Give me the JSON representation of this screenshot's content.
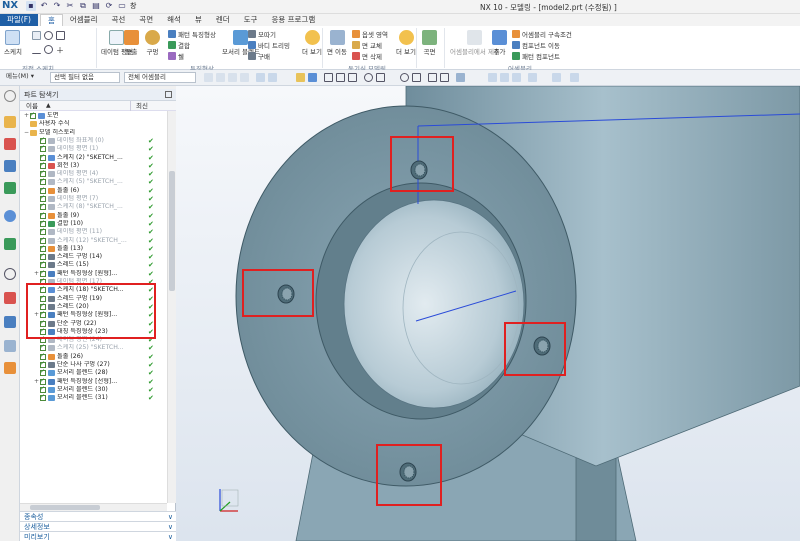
{
  "app": {
    "logo": "NX",
    "window_title": "NX 10 - 모델링 - [model2.prt (수정됨) ]",
    "qat_label": "창"
  },
  "menu": {
    "tabs": [
      "파일(F)",
      "홈",
      "어셈블리",
      "곡선",
      "곡면",
      "해석",
      "뷰",
      "렌더",
      "도구",
      "응용 프로그램"
    ],
    "active": "홈"
  },
  "ribbon": {
    "sketch": "스케치",
    "datum_plane": "데이텀 평면",
    "extrude": "돌출",
    "hole": "구멍",
    "pattern_feature": "패턴 특징형상",
    "unite": "결합",
    "shell": "쉘",
    "assembly_cut": "모서리 블렌드",
    "chamfer": "모따기",
    "draft": "바디 트리밍",
    "more1": "구배",
    "more_label": "더 보기",
    "offset_region": "옵셋 영역",
    "replace_face": "면 교체",
    "delete_face": "면 삭제",
    "move_face": "면 이동",
    "more2": "더 보기",
    "curve": "곡면",
    "assembly_constraints": "어셈블리 구속조건",
    "component_move": "컴포넌트 이동",
    "pattern_component": "패턴 컴포넌트",
    "add": "추가",
    "assembly_nav": "어셈블리에서 제품",
    "group_direct_sketch": "직접 스케치",
    "group_feature": "특징형상",
    "group_sync": "동기식 모델링",
    "group_assembly": "어셈블리"
  },
  "cmdbar": {
    "menu": "메뉴(M) ▾",
    "filter": "선택 필터 없음",
    "scope": "전체 어셈블리"
  },
  "navigator": {
    "title": "파트 탐색기",
    "col_name": "이름",
    "col_latest": "최신",
    "rows": [
      {
        "label": "도면",
        "depth": 0,
        "expand": "+",
        "icon": "#5a8fd6",
        "check": true,
        "latest": false,
        "dim": false
      },
      {
        "label": "사용자 수식",
        "depth": 0,
        "expand": "",
        "icon": "#e9b44c",
        "check": false,
        "latest": false,
        "dim": false
      },
      {
        "label": "모델 히스토리",
        "depth": 0,
        "expand": "−",
        "icon": "#e9b44c",
        "check": false,
        "latest": false,
        "dim": false
      },
      {
        "label": "데이텀 좌표계 (0)",
        "depth": 1,
        "expand": "",
        "icon": "#b0b8c4",
        "check": true,
        "latest": true,
        "dim": true
      },
      {
        "label": "데이텀 평면 (1)",
        "depth": 1,
        "expand": "",
        "icon": "#b0b8c4",
        "check": true,
        "latest": true,
        "dim": true
      },
      {
        "label": "스케치 (2) \"SKETCH_...",
        "depth": 1,
        "expand": "",
        "icon": "#5a8fd6",
        "check": true,
        "latest": true,
        "dim": false
      },
      {
        "label": "회전 (3)",
        "depth": 1,
        "expand": "",
        "icon": "#d9534f",
        "check": true,
        "latest": true,
        "dim": false
      },
      {
        "label": "데이텀 평면 (4)",
        "depth": 1,
        "expand": "",
        "icon": "#b0b8c4",
        "check": true,
        "latest": true,
        "dim": true
      },
      {
        "label": "스케치 (5) \"SKETCH_...",
        "depth": 1,
        "expand": "",
        "icon": "#b0b8c4",
        "check": true,
        "latest": true,
        "dim": true
      },
      {
        "label": "돌출 (6)",
        "depth": 1,
        "expand": "",
        "icon": "#e8903a",
        "check": true,
        "latest": true,
        "dim": false
      },
      {
        "label": "데이텀 평면 (7)",
        "depth": 1,
        "expand": "",
        "icon": "#b0b8c4",
        "check": true,
        "latest": true,
        "dim": true
      },
      {
        "label": "스케치 (8) \"SKETCH_...",
        "depth": 1,
        "expand": "",
        "icon": "#b0b8c4",
        "check": true,
        "latest": true,
        "dim": true
      },
      {
        "label": "돌출 (9)",
        "depth": 1,
        "expand": "",
        "icon": "#e8903a",
        "check": true,
        "latest": true,
        "dim": false
      },
      {
        "label": "결합 (10)",
        "depth": 1,
        "expand": "",
        "icon": "#3a9a5a",
        "check": true,
        "latest": true,
        "dim": false
      },
      {
        "label": "데이텀 평면 (11)",
        "depth": 1,
        "expand": "",
        "icon": "#b0b8c4",
        "check": true,
        "latest": true,
        "dim": true
      },
      {
        "label": "스케치 (12) \"SKETCH_...",
        "depth": 1,
        "expand": "",
        "icon": "#b0b8c4",
        "check": true,
        "latest": true,
        "dim": true
      },
      {
        "label": "돌출 (13)",
        "depth": 1,
        "expand": "",
        "icon": "#e8903a",
        "check": true,
        "latest": true,
        "dim": false
      },
      {
        "label": "스레드 구멍 (14)",
        "depth": 1,
        "expand": "",
        "icon": "#6c7a8a",
        "check": true,
        "latest": true,
        "dim": false
      },
      {
        "label": "스레드 (15)",
        "depth": 1,
        "expand": "",
        "icon": "#6c7a8a",
        "check": true,
        "latest": true,
        "dim": false
      },
      {
        "label": "패턴 특징형상 [원형]...",
        "depth": 1,
        "expand": "+",
        "icon": "#4a7fc0",
        "check": true,
        "latest": true,
        "dim": false
      },
      {
        "label": "데이텀 평면 (17)",
        "depth": 1,
        "expand": "",
        "icon": "#b0b8c4",
        "check": true,
        "latest": true,
        "dim": true
      },
      {
        "label": "스케치 (18) \"SKETCH...",
        "depth": 1,
        "expand": "",
        "icon": "#5a8fd6",
        "check": true,
        "latest": true,
        "dim": false
      },
      {
        "label": "스레드 구멍 (19)",
        "depth": 1,
        "expand": "",
        "icon": "#6c7a8a",
        "check": true,
        "latest": true,
        "dim": false
      },
      {
        "label": "스레드 (20)",
        "depth": 1,
        "expand": "",
        "icon": "#6c7a8a",
        "check": true,
        "latest": true,
        "dim": false
      },
      {
        "label": "패턴 특징형상 [원형]...",
        "depth": 1,
        "expand": "+",
        "icon": "#4a7fc0",
        "check": true,
        "latest": true,
        "dim": false
      },
      {
        "label": "단순 구멍 (22)",
        "depth": 1,
        "expand": "",
        "icon": "#6c7a8a",
        "check": true,
        "latest": true,
        "dim": false
      },
      {
        "label": "대칭 특징형상 (23)",
        "depth": 1,
        "expand": "",
        "icon": "#4a7fc0",
        "check": true,
        "latest": true,
        "dim": false
      },
      {
        "label": "데이텀 평면 (24)",
        "depth": 1,
        "expand": "",
        "icon": "#b0b8c4",
        "check": true,
        "latest": true,
        "dim": true
      },
      {
        "label": "스케치 (25) \"SKETCH...",
        "depth": 1,
        "expand": "",
        "icon": "#b0b8c4",
        "check": true,
        "latest": true,
        "dim": true
      },
      {
        "label": "돌출 (26)",
        "depth": 1,
        "expand": "",
        "icon": "#e8903a",
        "check": true,
        "latest": true,
        "dim": false
      },
      {
        "label": "단순 나사 구멍 (27)",
        "depth": 1,
        "expand": "",
        "icon": "#6c7a8a",
        "check": true,
        "latest": true,
        "dim": false
      },
      {
        "label": "모서리 블렌드 (28)",
        "depth": 1,
        "expand": "",
        "icon": "#5a9ad6",
        "check": true,
        "latest": true,
        "dim": false
      },
      {
        "label": "패턴 특징형상 [선형]...",
        "depth": 1,
        "expand": "+",
        "icon": "#4a7fc0",
        "check": true,
        "latest": true,
        "dim": false
      },
      {
        "label": "모서리 블렌드 (30)",
        "depth": 1,
        "expand": "",
        "icon": "#5a9ad6",
        "check": true,
        "latest": true,
        "dim": false
      },
      {
        "label": "모서리 블렌드 (31)",
        "depth": 1,
        "expand": "",
        "icon": "#5a9ad6",
        "check": true,
        "latest": true,
        "dim": false
      }
    ],
    "panels": [
      "종속성",
      "상세정보",
      "미리보기"
    ]
  },
  "colors": {
    "accent": "#1f5fa6",
    "highlight_box": "#e02020",
    "model_surface": "#8faab7",
    "model_dark": "#5d7a88"
  }
}
